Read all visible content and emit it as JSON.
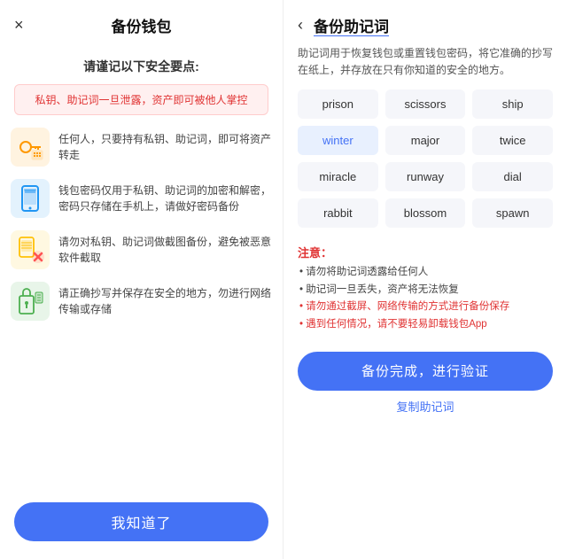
{
  "left": {
    "title": "备份钱包",
    "close_label": "×",
    "security_heading": "请谨记以下安全要点:",
    "warning": "私钥、助记词一旦泄露，资产即可被他人掌控",
    "items": [
      {
        "icon": "key-icon",
        "text": "任何人，只要持有私钥、助记词，即可将资产转走"
      },
      {
        "icon": "phone-icon",
        "text": "钱包密码仅用于私钥、助记词的加密和解密，密码只存储在手机上，请做好密码备份"
      },
      {
        "icon": "scan-icon",
        "text": "请勿对私钥、助记词做截图备份，避免被恶意软件截取"
      },
      {
        "icon": "doc-icon",
        "text": "请正确抄写并保存在安全的地方，勿进行网络传输或存储"
      }
    ],
    "button": "我知道了"
  },
  "right": {
    "title": "备份助记词",
    "back_label": "‹",
    "desc": "助记词用于恢复钱包或重置钱包密码，将它准确的抄写在纸上，并存放在只有你知道的安全的地方。",
    "words": [
      "prison",
      "scissors",
      "ship",
      "winter",
      "major",
      "twice",
      "miracle",
      "runway",
      "dial",
      "rabbit",
      "blossom",
      "spawn"
    ],
    "highlighted_word": "winter",
    "notice_title": "注意：",
    "notice_items": [
      "• 请勿将助记词透露给任何人",
      "• 助记词一旦丢失，资产将无法恢复",
      "• 请勿通过截屏、网络传输的方式进行备份保存",
      "• 遇到任何情况，请不要轻易卸载钱包App"
    ],
    "button": "备份完成，进行验证",
    "copy_link": "复制助记词"
  }
}
